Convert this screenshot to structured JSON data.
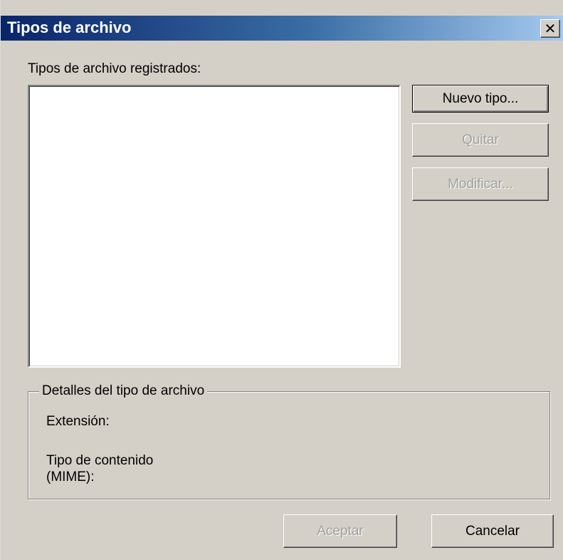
{
  "dialog": {
    "title": "Tipos de archivo",
    "close_glyph": "✕"
  },
  "registered": {
    "label": "Tipos de archivo registrados:",
    "items": []
  },
  "side_buttons": {
    "new_type": "Nuevo tipo...",
    "remove": "Quitar",
    "modify": "Modificar..."
  },
  "details": {
    "legend": "Detalles del tipo de archivo",
    "extension_label": "Extensión:",
    "content_type_label_line1": "Tipo de contenido",
    "content_type_label_line2": "(MIME):"
  },
  "footer": {
    "accept": "Aceptar",
    "cancel": "Cancelar"
  },
  "colors": {
    "titlebar_start": "#0a246a",
    "titlebar_end": "#a6caf0",
    "dialog_face": "#d4d0c8",
    "disabled_text": "#a0a0a0"
  }
}
